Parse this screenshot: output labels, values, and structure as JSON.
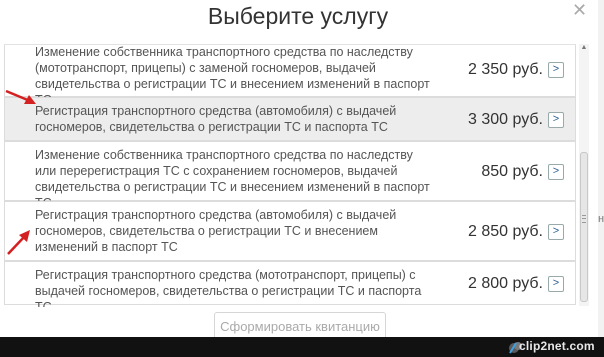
{
  "dialog": {
    "title": "Выберите услугу",
    "close_icon": "✕"
  },
  "services": [
    {
      "description": "Изменение собственника транспортного средства по наследству (мототранспорт, прицепы) с заменой госномеров, выдачей свидетельства о регистрации ТС и внесением изменений в паспорт ТС",
      "price": "2 350 руб."
    },
    {
      "description": "Регистрация транспортного средства (автомобиля) с выдачей госномеров, свидетельства о регистрации ТС и паспорта ТС",
      "price": "3 300 руб."
    },
    {
      "description": "Изменение собственника транспортного средства по наследству или перерегистрация ТС с сохранением госномеров, выдачей свидетельства о регистрации ТС и внесением изменений в паспорт ТС",
      "price": "850 руб."
    },
    {
      "description": "Регистрация транспортного средства (автомобиля) с выдачей госномеров, свидетельства о регистрации ТС и внесением изменений в паспорт ТС",
      "price": "2 850 руб."
    },
    {
      "description": "Регистрация транспортного средства (мототранспорт, прицепы) с выдачей госномеров, свидетельства о регистрации ТС и паспорта ТС",
      "price": "2 800 руб."
    }
  ],
  "row_button_glyph": ">",
  "submit_label": "Сформировать квитанцию",
  "watermark": "clip2net.com",
  "side_strip_text": "н",
  "colors": {
    "annotation_arrow": "#d42020",
    "highlight_row": "#ededed"
  }
}
